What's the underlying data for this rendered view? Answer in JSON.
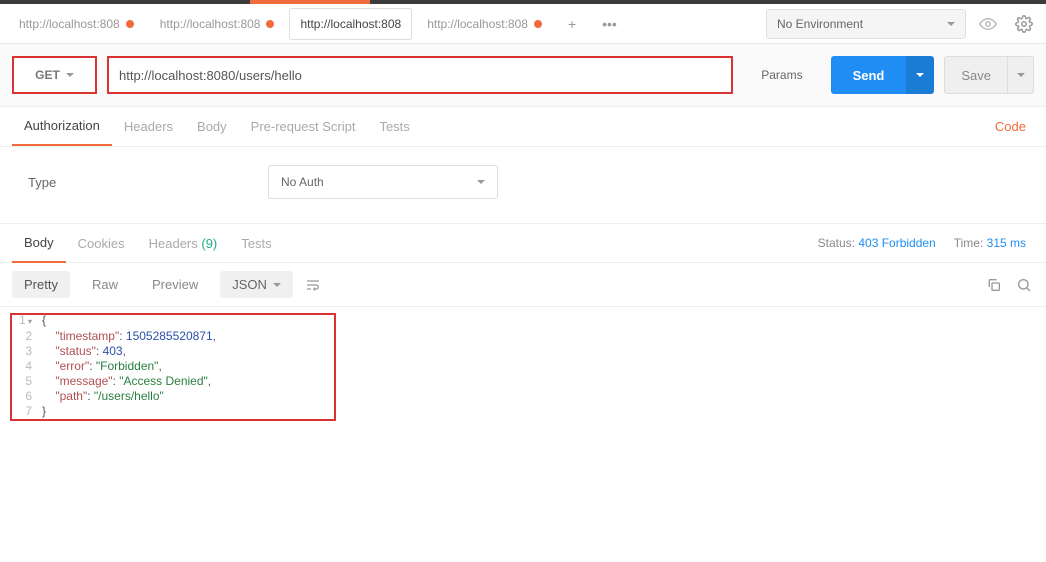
{
  "tabs": [
    {
      "label": "http://localhost:808",
      "dirty": true,
      "active": false
    },
    {
      "label": "http://localhost:808",
      "dirty": true,
      "active": false
    },
    {
      "label": "http://localhost:808",
      "dirty": false,
      "active": true
    },
    {
      "label": "http://localhost:808",
      "dirty": true,
      "active": false
    }
  ],
  "env": {
    "label": "No Environment"
  },
  "request": {
    "method": "GET",
    "url": "http://localhost:8080/users/hello",
    "params_label": "Params",
    "send_label": "Send",
    "save_label": "Save"
  },
  "reqSubTabs": {
    "authorization": "Authorization",
    "headers": "Headers",
    "body": "Body",
    "prerequest": "Pre-request Script",
    "tests": "Tests",
    "code": "Code"
  },
  "auth": {
    "type_label": "Type",
    "type_value": "No Auth"
  },
  "respTabs": {
    "body": "Body",
    "cookies": "Cookies",
    "headers": "Headers",
    "headers_count": "(9)",
    "tests": "Tests"
  },
  "respMeta": {
    "status_label": "Status:",
    "status_value": "403 Forbidden",
    "time_label": "Time:",
    "time_value": "315 ms"
  },
  "toolbar": {
    "pretty": "Pretty",
    "raw": "Raw",
    "preview": "Preview",
    "format": "JSON"
  },
  "responseBody": {
    "timestamp": 1505285520871,
    "status": 403,
    "error": "Forbidden",
    "message": "Access Denied",
    "path": "/users/hello"
  },
  "codeLines": [
    {
      "n": "1",
      "html": "<span class='p'>{</span>"
    },
    {
      "n": "2",
      "html": "    <span class='k'>\"timestamp\"</span><span class='p'>: </span><span class='n'>1505285520871</span><span class='p'>,</span>"
    },
    {
      "n": "3",
      "html": "    <span class='k'>\"status\"</span><span class='p'>: </span><span class='n'>403</span><span class='p'>,</span>"
    },
    {
      "n": "4",
      "html": "    <span class='k'>\"error\"</span><span class='p'>: </span><span class='s'>\"Forbidden\"</span><span class='p'>,</span>"
    },
    {
      "n": "5",
      "html": "    <span class='k'>\"message\"</span><span class='p'>: </span><span class='s'>\"Access Denied\"</span><span class='p'>,</span>"
    },
    {
      "n": "6",
      "html": "    <span class='k'>\"path\"</span><span class='p'>: </span><span class='s'>\"/users/hello\"</span>"
    },
    {
      "n": "7",
      "html": "<span class='p'>}</span>"
    }
  ]
}
